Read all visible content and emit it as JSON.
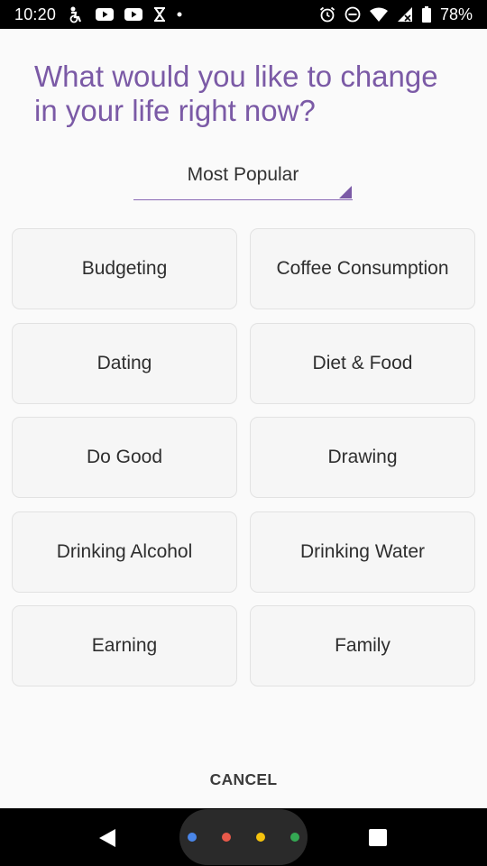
{
  "status_bar": {
    "time": "10:20",
    "battery": "78%",
    "left_icons": [
      "accessibility-icon",
      "youtube-icon",
      "youtube-icon",
      "hourglass-icon",
      "dot-icon"
    ],
    "right_icons": [
      "alarm-icon",
      "do-not-disturb-icon",
      "wifi-icon",
      "signal-icon",
      "battery-icon"
    ]
  },
  "title": "What would you like to change in your life right now?",
  "filter": {
    "selected": "Most Popular"
  },
  "options": [
    "Budgeting",
    "Coffee Consumption",
    "Dating",
    "Diet & Food",
    "Do Good",
    "Drawing",
    "Drinking Alcohol",
    "Drinking Water",
    "Earning",
    "Family"
  ],
  "cancel_label": "CANCEL",
  "colors": {
    "accent": "#7b5aa6",
    "nav_dots": [
      "#4a86e8",
      "#e8594a",
      "#f4c20d",
      "#34a853"
    ]
  }
}
